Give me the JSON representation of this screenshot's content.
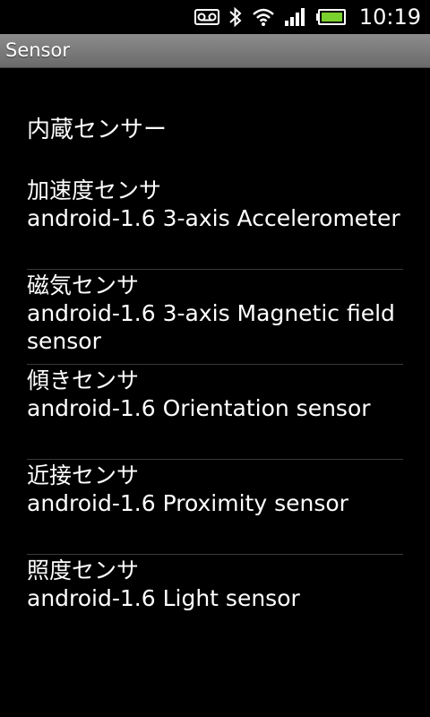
{
  "status_bar": {
    "time": "10:19",
    "icons": [
      "voicemail-icon",
      "bluetooth-icon",
      "wifi-icon",
      "signal-icon",
      "battery-icon"
    ]
  },
  "app": {
    "title": "Sensor"
  },
  "section_header": "内蔵センサー",
  "sensors": [
    {
      "name": "加速度センサ",
      "description": "android-1.6 3-axis Accelerometer"
    },
    {
      "name": "磁気センサ",
      "description": "android-1.6 3-axis Magnetic field sensor"
    },
    {
      "name": "傾きセンサ",
      "description": "android-1.6 Orientation sensor"
    },
    {
      "name": "近接センサ",
      "description": "android-1.6 Proximity sensor"
    },
    {
      "name": "照度センサ",
      "description": "android-1.6 Light sensor"
    }
  ],
  "colors": {
    "background": "#000000",
    "text": "#ffffff",
    "title_bar": "#7a7a7a",
    "battery": "#7ad12e",
    "divider": "#3a3a3a"
  }
}
